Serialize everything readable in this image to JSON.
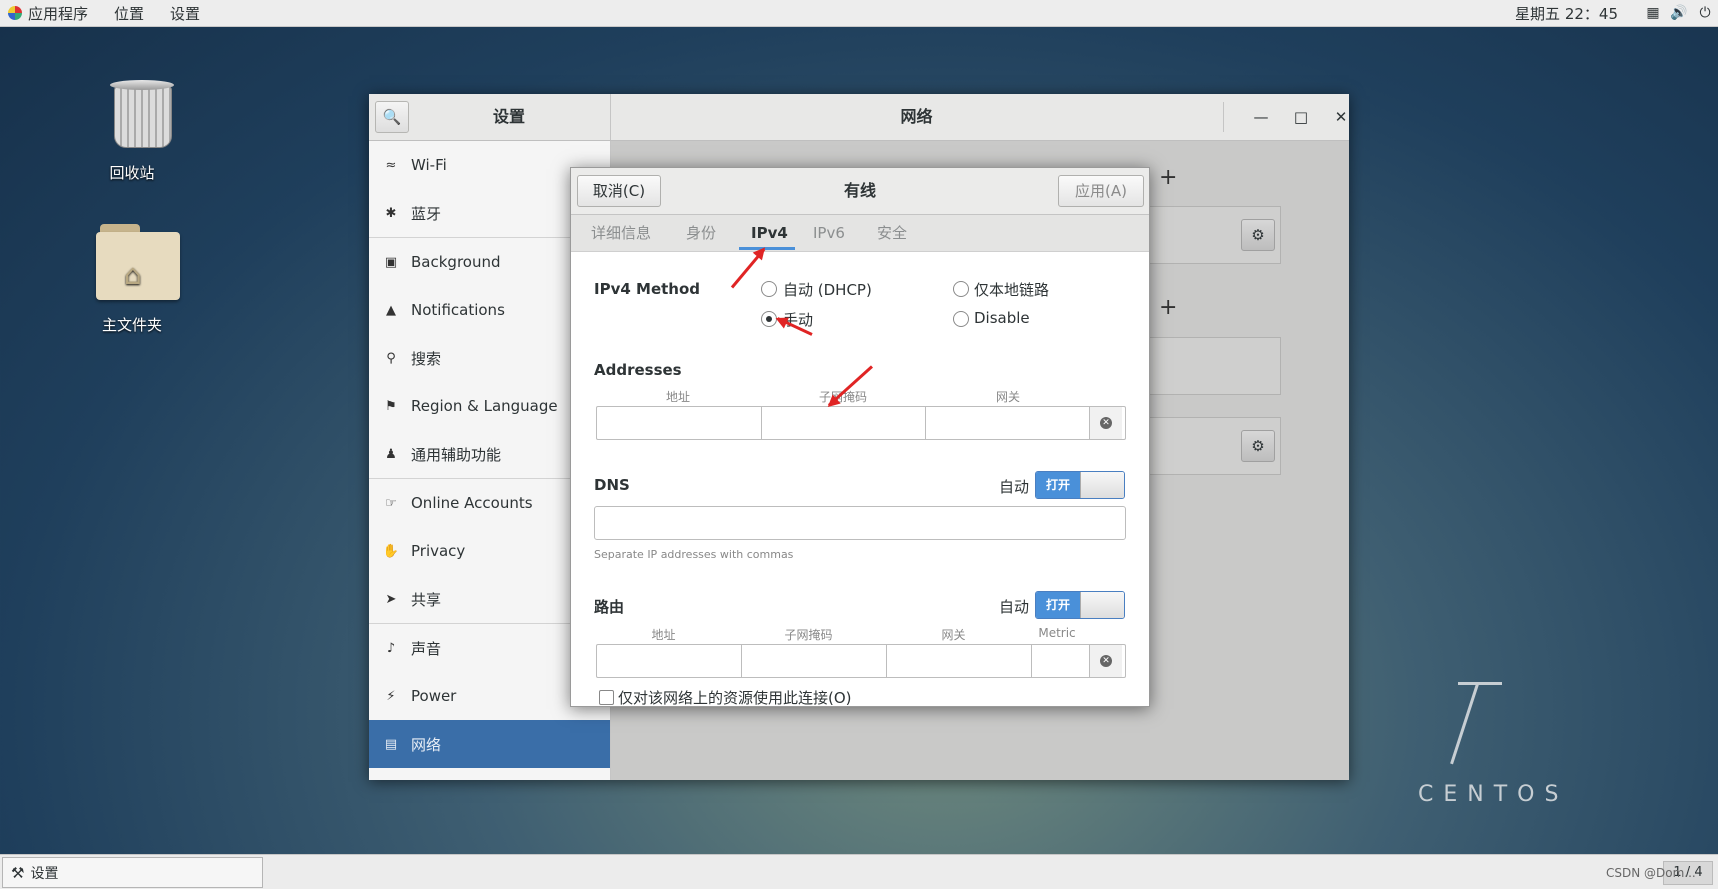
{
  "topbar": {
    "menus": [
      "应用程序",
      "位置",
      "设置"
    ],
    "clock": "星期五 22：45",
    "icons": [
      "network-icon",
      "volume-icon",
      "power-icon"
    ]
  },
  "desktop": {
    "trash_label": "回收站",
    "home_label": "主文件夹"
  },
  "settings_window": {
    "left_title": "设置",
    "right_title": "网络",
    "sidebar": [
      {
        "label": "Wi-Fi",
        "icon": "wifi-icon"
      },
      {
        "label": "蓝牙",
        "icon": "bluetooth-icon"
      },
      {
        "label": "Background",
        "icon": "background-icon"
      },
      {
        "label": "Notifications",
        "icon": "bell-icon"
      },
      {
        "label": "搜索",
        "icon": "search-icon"
      },
      {
        "label": "Region & Language",
        "icon": "flag-icon"
      },
      {
        "label": "通用辅助功能",
        "icon": "accessibility-icon"
      },
      {
        "label": "Online Accounts",
        "icon": "accounts-icon"
      },
      {
        "label": "Privacy",
        "icon": "hand-icon"
      },
      {
        "label": "共享",
        "icon": "share-icon"
      },
      {
        "label": "声音",
        "icon": "speaker-icon"
      },
      {
        "label": "Power",
        "icon": "power-icon"
      },
      {
        "label": "网络",
        "icon": "network-icon",
        "selected": true
      }
    ]
  },
  "dialog": {
    "cancel": "取消(C)",
    "title": "有线",
    "apply": "应用(A)",
    "tabs": [
      "详细信息",
      "身份",
      "IPv4",
      "IPv6",
      "安全"
    ],
    "active_tab": "IPv4",
    "ipv4_method_label": "IPv4 Method",
    "methods": {
      "auto": "自动 (DHCP)",
      "link_local": "仅本地链路",
      "manual": "手动",
      "disable": "Disable"
    },
    "selected_method": "手动",
    "addresses": {
      "title": "Addresses",
      "col_address": "地址",
      "col_netmask": "子网掩码",
      "col_gateway": "网关"
    },
    "dns": {
      "title": "DNS",
      "auto_label": "自动",
      "switch_label": "打开",
      "hint": "Separate IP addresses with commas"
    },
    "routes": {
      "title": "路由",
      "auto_label": "自动",
      "switch_label": "打开",
      "col_address": "地址",
      "col_netmask": "子网掩码",
      "col_gateway": "网关",
      "col_metric": "Metric"
    },
    "only_local_checkbox": "仅对该网络上的资源使用此连接(O)"
  },
  "centos": {
    "version": "7",
    "word": "CENTOS"
  },
  "taskbar": {
    "item": "设置",
    "pager": "1 / 4",
    "watermark": "CSDN @Dom...",
    "accent": "#3a6ea8"
  }
}
